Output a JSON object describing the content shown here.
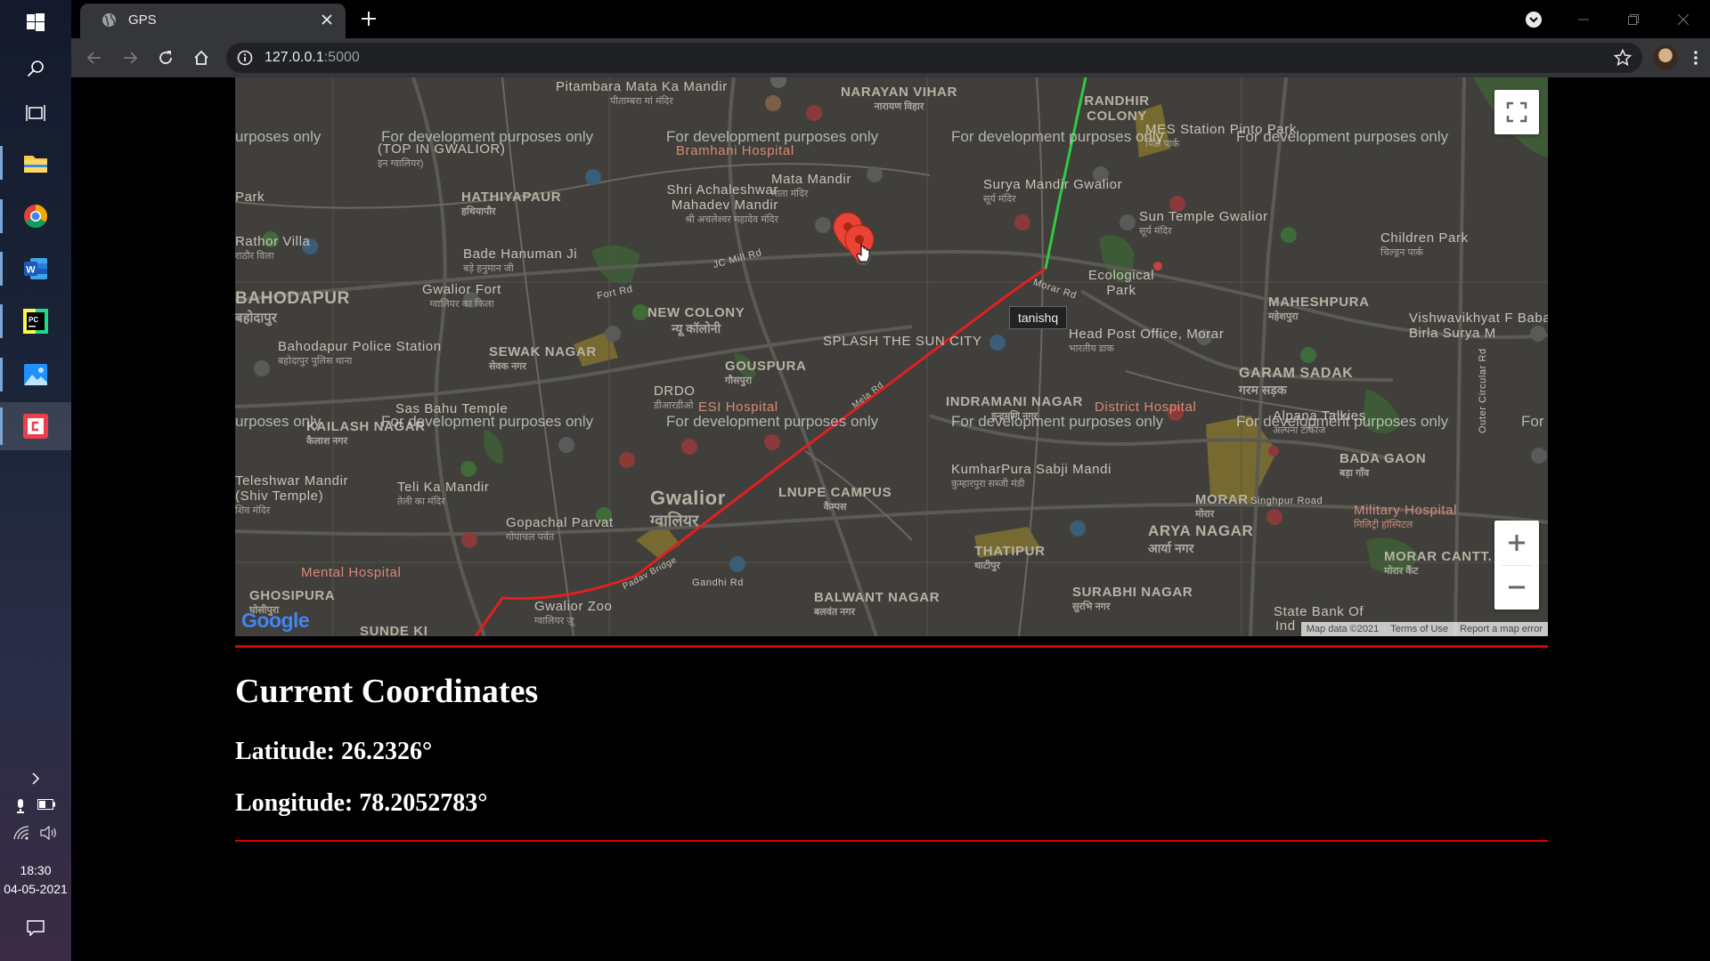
{
  "taskbar": {
    "clock_time": "18:30",
    "clock_date": "04-05-2021"
  },
  "browser": {
    "tab_title": "GPS",
    "url_host": "127.0.0.1",
    "url_rest": ":5000"
  },
  "map": {
    "watermark": "For development purposes only",
    "watermark_left_cut": "urposes only",
    "watermark_right_cut": "For",
    "marker_tooltip": "tanishq",
    "logo_text": "Google",
    "attribution": {
      "map_data": "Map data ©2021",
      "terms": "Terms of Use",
      "report": "Report a map error"
    },
    "labels": {
      "pitambara": "Pitambara Mata Ka Mandir",
      "pitambara_hi": "पीताम्बरा मां मंदिर",
      "narayan_vihar": "NARAYAN VIHAR",
      "narayan_vihar_hi": "नारायण विहार",
      "randhir_colony": "RANDHIR COLONY",
      "mes_station": "MES Station Pinto Park",
      "mes_station_hi": "पिंटो पार्क",
      "bramhani": "Bramhani Hospital",
      "top_in_gwalior": "(TOP IN GWALIOR)",
      "top_in_gwalior_hi": "इन ग्वालियर)",
      "mata_mandir": "Mata Mandir",
      "mata_mandir_hi": "माता मंदिर",
      "shri_achaleshwar": "Shri Achaleshwar Mahadev Mandir",
      "shri_achaleshwar_hi": "श्री अचलेश्वर महादेव मंदिर",
      "hathiyapaur": "HATHIYAPAUR",
      "hathiyapaur_hi": "हथियापौर",
      "park": "Park",
      "surya_mandir": "Surya Mandir Gwalior",
      "surya_mandir_hi": "सूर्य मंदिर",
      "sun_temple": "Sun Temple Gwalior",
      "sun_temple_hi": "सूर्य मंदिर",
      "childrens_park": "Children Park",
      "childrens_park_hi": "चिल्ड्रन पार्क",
      "rathor_villa": "Rathor Villa",
      "rathor_villa_hi": "राठौर विला",
      "bade_hanuman": "Bade Hanuman Ji",
      "bade_hanuman_hi": "बड़े हनुमान जी",
      "jc_mill_rd": "JC Mill Rd",
      "ecological_park": "Ecological Park",
      "morar_rd": "Morar Rd",
      "bahodapur": "BAHODAPUR",
      "bahodapur_hi": "बहोदापुर",
      "gwalior_fort": "Gwalior Fort",
      "gwalior_fort_hi": "ग्वालियर का किला",
      "fort_rd": "Fort Rd",
      "new_colony": "NEW COLONY",
      "new_colony_hi": "न्यू कॉलोनी",
      "maheshpura": "MAHESHPURA",
      "maheshpura_hi": "महेशपुरा",
      "vishwavikhyat": "Vishwavikhyat F Baba Birla Surya M",
      "bahodapur_police": "Bahodapur Police Station",
      "bahodapur_police_hi": "बहोदापुर पुलिस थाना",
      "sewak_nagar": "SEWAK NAGAR",
      "sewak_nagar_hi": "सेवक नगर",
      "splash_sun_city": "SPLASH THE SUN CITY",
      "head_post_office": "Head Post Office, Morar",
      "head_post_office_hi": "भारतीय डाक",
      "gouspura": "GOUSPURA",
      "gouspura_hi": "गौसपुरा",
      "garam_sadak": "GARAM SADAK",
      "garam_sadak_hi": "गरम सड़क",
      "drdo": "DRDO",
      "drdo_hi": "डीआरडीओ",
      "sas_bahu": "Sas Bahu Temple",
      "kailash_nagar": "KAILASH NAGAR",
      "kailash_nagar_hi": "कैलाश नगर",
      "esi_hospital": "ESI Hospital",
      "mela_rd": "Mela Rd",
      "indramani_nagar": "INDRAMANI NAGAR",
      "indramani_nagar_hi": "इन्द्रमणि नगर",
      "district_hospital": "District Hospital",
      "alpana_talkies": "Alpana Talkies",
      "alpana_talkies_hi": "अल्पना टॉकीज",
      "bada_gaon": "BADA GAON",
      "bada_gaon_hi": "बड़ा गाँव",
      "outer_circular_rd": "Outer Circular Rd",
      "teleshwar": "Teleshwar Mandir (Shiv Temple)",
      "teleshwar_hi": "शिव मंदिर",
      "teli_ka_mandir": "Teli Ka Mandir",
      "teli_ka_mandir_hi": "तेली का मंदिर",
      "gwalior": "Gwalior",
      "gwalior_hi": "ग्वालियर",
      "lnupe": "LNUPE CAMPUS",
      "lnupe_hi": "कैम्पस",
      "kumharpura": "KumharPura Sabji Mandi",
      "kumharpura_hi": "कुम्हारपुरा सब्जी मंडी",
      "morar": "MORAR",
      "morar_hi": "मोरार",
      "singhpur_rd": "Singhpur Road",
      "military_hospital": "Military Hospital",
      "military_hospital_hi": "मिलिट्री हॉस्पिटल",
      "gopachal": "Gopachal Parvat",
      "gopachal_hi": "गोपाचल पर्वत",
      "arya_nagar": "ARYA NAGAR",
      "arya_nagar_hi": "आर्या नगर",
      "mental_hospital": "Mental Hospital",
      "thatipur": "THATIPUR",
      "thatipur_hi": "थाटीपुर",
      "morar_cantt": "MORAR CANTT.",
      "morar_cantt_hi": "मोरार कैंट",
      "ghosipura": "GHOSIPURA",
      "ghosipura_hi": "घोसीपुरा",
      "padav_bridge": "Padav Bridge",
      "gandhi_rd": "Gandhi Rd",
      "balwant_nagar": "BALWANT NAGAR",
      "balwant_nagar_hi": "बलवंत नगर",
      "surabhi_nagar": "SURABHI NAGAR",
      "surabhi_nagar_hi": "सुरभि नगर",
      "state_bank": "State Bank Of",
      "gwalior_zoo": "Gwalior Zoo",
      "gwalior_zoo_hi": "ग्वालियर ज़ू",
      "sunder_ki": "SUNDE KI",
      "ind": "Ind"
    }
  },
  "coordinates": {
    "title": "Current Coordinates",
    "latitude": "Latitude: 26.2326°",
    "longitude": "Longitude: 78.2052783°"
  },
  "colors": {
    "route_red": "#e0201f",
    "route_green": "#2ecc40",
    "rule_red": "#dd0000"
  }
}
